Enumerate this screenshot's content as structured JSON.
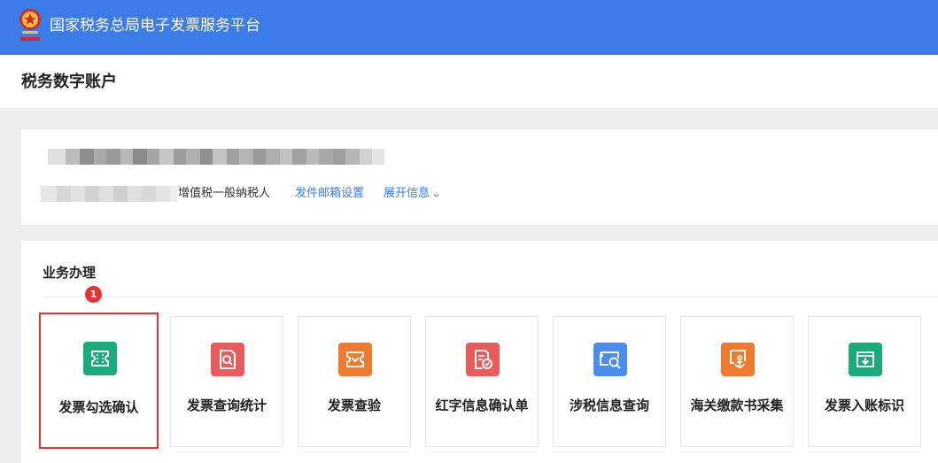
{
  "header": {
    "platform_title": "国家税务总局电子发票服务平台",
    "logo_icon": "tax-emblem-icon",
    "brand_color": "#3c7ce8"
  },
  "subheader": {
    "title": "税务数字账户"
  },
  "account": {
    "taxpayer_type": "增值税一般纳税人",
    "email_settings_link": "发件邮箱设置",
    "expand_info_link": "展开信息",
    "expand_icon": "chevron-down-icon",
    "link_color": "#3c7ce8"
  },
  "business": {
    "section_title": "业务办理",
    "step_badge": "1",
    "highlight_color": "#e8322f",
    "tiles": [
      {
        "label": "发票勾选确认",
        "icon": "ticket-icon",
        "color": "#1bab7a",
        "selected": true
      },
      {
        "label": "发票查询统计",
        "icon": "invoice-search-icon",
        "color": "#e85c5c",
        "selected": false
      },
      {
        "label": "发票查验",
        "icon": "ticket-check-icon",
        "color": "#f07b2f",
        "selected": false
      },
      {
        "label": "红字信息确认单",
        "icon": "red-invoice-confirm-icon",
        "color": "#e85c5c",
        "selected": false
      },
      {
        "label": "涉税信息查询",
        "icon": "tax-info-search-icon",
        "color": "#4a8df0",
        "selected": false
      },
      {
        "label": "海关缴款书采集",
        "icon": "customs-anchor-icon",
        "color": "#f07b2f",
        "selected": false
      },
      {
        "label": "发票入账标识",
        "icon": "invoice-download-icon",
        "color": "#1bab7a",
        "selected": false
      }
    ]
  }
}
